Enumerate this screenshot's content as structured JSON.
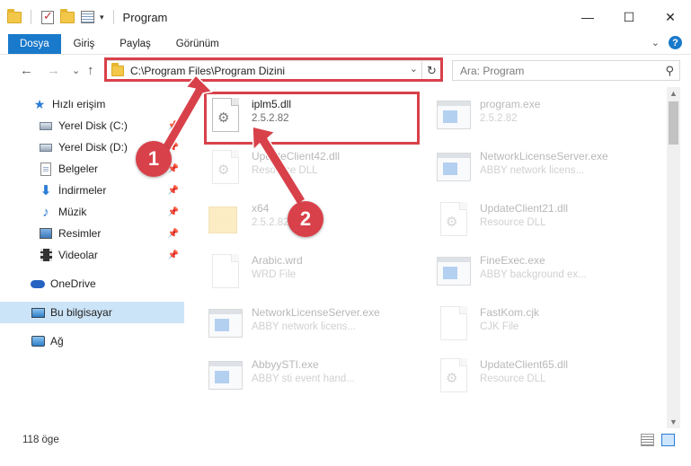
{
  "window": {
    "title": "Program",
    "minimize_glyph": "—",
    "maximize_glyph": "☐",
    "close_glyph": "✕"
  },
  "ribbon": {
    "tabs": [
      "Dosya",
      "Giriş",
      "Paylaş",
      "Görünüm"
    ],
    "chevron_glyph": "⌄",
    "help_glyph": "?"
  },
  "nav": {
    "back_glyph": "←",
    "forward_glyph": "→",
    "recent_glyph": "⌄",
    "up_glyph": "↑",
    "address_path": "C:\\Program Files\\Program Dizini",
    "address_dropdown_glyph": "⌄",
    "refresh_glyph": "↻",
    "search_placeholder": "Ara: Program",
    "search_glyph": "⚲"
  },
  "sidebar": {
    "items": [
      {
        "label": "Hızlı erişim",
        "icon": "star-icon"
      },
      {
        "label": "Yerel Disk (C:)",
        "icon": "disk-icon",
        "pinned": true
      },
      {
        "label": "Yerel Disk (D:)",
        "icon": "disk-icon",
        "pinned": true
      },
      {
        "label": "Belgeler",
        "icon": "documents-icon",
        "pinned": true
      },
      {
        "label": "İndirmeler",
        "icon": "downloads-icon",
        "pinned": true
      },
      {
        "label": "Müzik",
        "icon": "music-icon",
        "pinned": true
      },
      {
        "label": "Resimler",
        "icon": "pictures-icon",
        "pinned": true
      },
      {
        "label": "Videolar",
        "icon": "videos-icon",
        "pinned": true
      },
      {
        "label": "OneDrive",
        "icon": "onedrive-icon"
      },
      {
        "label": "Bu bilgisayar",
        "icon": "this-pc-icon",
        "selected": true
      },
      {
        "label": "Ağ",
        "icon": "network-icon"
      }
    ],
    "pin_glyph": "📌"
  },
  "files": [
    {
      "name": "iplm5.dll",
      "sub": "2.5.2.82",
      "icon": "dll-icon"
    },
    {
      "name": "program.exe",
      "sub": "2.5.2.82",
      "icon": "exe-icon"
    },
    {
      "name": "UpdateClient42.dll",
      "sub": "Resource DLL",
      "icon": "dll-icon"
    },
    {
      "name": "NetworkLicenseServer.exe",
      "sub": "ABBY network licens...",
      "icon": "exe-icon"
    },
    {
      "name": "x64",
      "sub": "2.5.2.82",
      "icon": "folder-icon"
    },
    {
      "name": "UpdateClient21.dll",
      "sub": "Resource DLL",
      "icon": "dll-icon"
    },
    {
      "name": "Arabic.wrd",
      "sub": "WRD File",
      "icon": "file-icon"
    },
    {
      "name": "FineExec.exe",
      "sub": "ABBY background ex...",
      "icon": "exe-icon"
    },
    {
      "name": "NetworkLicenseServer.exe",
      "sub": "ABBY network licens...",
      "icon": "exe-icon"
    },
    {
      "name": "FastKom.cjk",
      "sub": "CJK File",
      "icon": "file-icon"
    },
    {
      "name": "AbbyySTI.exe",
      "sub": "ABBY sti event hand...",
      "icon": "exe-icon"
    },
    {
      "name": "UpdateClient65.dll",
      "sub": "Resource DLL",
      "icon": "dll-icon"
    }
  ],
  "callouts": [
    "1",
    "2"
  ],
  "colors": {
    "accent": "#1979ca",
    "highlight": "#d8414a",
    "selected_nav": "#cce4f7"
  },
  "status": {
    "item_count": "118 öge"
  }
}
